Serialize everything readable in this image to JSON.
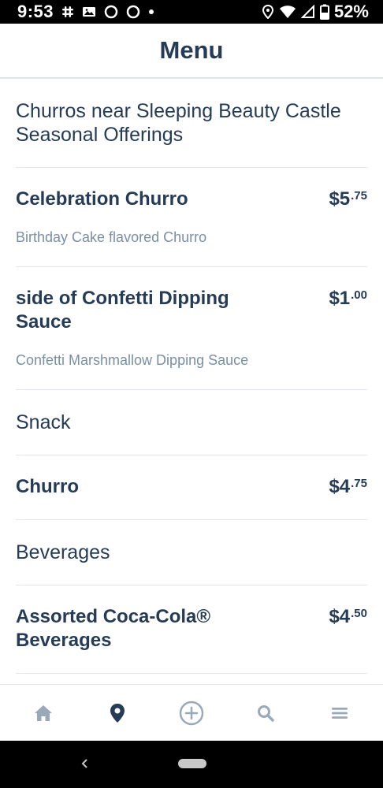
{
  "status_bar": {
    "time": "9:53",
    "battery": "52%",
    "icons": [
      "slack-icon",
      "photo-icon",
      "circle-icon",
      "circle-icon",
      "dot-icon",
      "location-icon",
      "wifi-icon",
      "signal-icon",
      "battery-icon"
    ]
  },
  "header": {
    "title": "Menu"
  },
  "menu": {
    "section_title": "Churros near Sleeping Beauty Castle Seasonal Offerings",
    "items": [
      {
        "name": "Celebration Churro",
        "price_dollars": "$5",
        "price_cents": ".75",
        "description": "Birthday Cake flavored Churro"
      },
      {
        "name": "side of Confetti Dipping Sauce",
        "price_dollars": "$1",
        "price_cents": ".00",
        "description": "Confetti Marshmallow Dipping Sauce"
      }
    ],
    "categories": [
      {
        "title": "Snack"
      },
      {
        "title": "Beverages"
      }
    ],
    "snack_items": [
      {
        "name": "Churro",
        "price_dollars": "$4",
        "price_cents": ".75"
      }
    ],
    "beverage_items": [
      {
        "name": "Assorted Coca-Cola® Beverages",
        "price_dollars": "$4",
        "price_cents": ".50"
      }
    ]
  },
  "tab_bar": {
    "tabs": [
      {
        "icon": "home-icon",
        "active": false
      },
      {
        "icon": "location-pin-icon",
        "active": true
      },
      {
        "icon": "add-circle-icon",
        "active": false
      },
      {
        "icon": "search-icon",
        "active": false
      },
      {
        "icon": "menu-icon",
        "active": false
      }
    ]
  },
  "colors": {
    "primary_text": "#253b56",
    "secondary_text": "#7a8fa6",
    "inactive_icon": "#9aa9ba",
    "divider": "#e4e8ee"
  }
}
